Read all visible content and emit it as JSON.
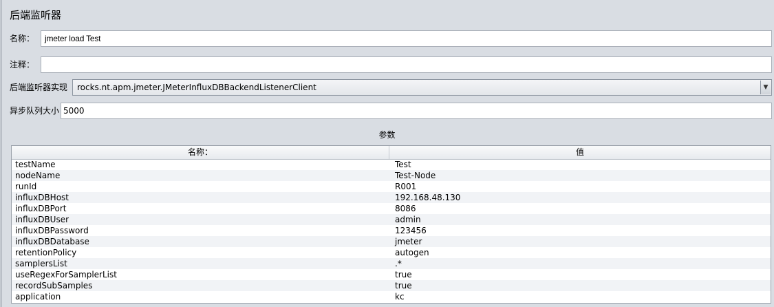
{
  "panel": {
    "title": "后端监听器"
  },
  "form": {
    "name_label": "名称：",
    "name_value": "jmeter load Test",
    "comment_label": "注释：",
    "comment_value": "",
    "impl_label": "后端监听器实现",
    "impl_value": "rocks.nt.apm.jmeter.JMeterInfluxDBBackendListenerClient",
    "queue_label": "异步队列大小",
    "queue_value": "5000"
  },
  "params": {
    "section_title": "参数",
    "headers": [
      "名称：",
      "值"
    ],
    "rows": [
      [
        "testName",
        "Test"
      ],
      [
        "nodeName",
        "Test-Node"
      ],
      [
        "runId",
        "R001"
      ],
      [
        "influxDBHost",
        "192.168.48.130"
      ],
      [
        "influxDBPort",
        "8086"
      ],
      [
        "influxDBUser",
        "admin"
      ],
      [
        "influxDBPassword",
        "123456"
      ],
      [
        "influxDBDatabase",
        "jmeter"
      ],
      [
        "retentionPolicy",
        "autogen"
      ],
      [
        "samplersList",
        ".*"
      ],
      [
        "useRegexForSamplerList",
        "true"
      ],
      [
        "recordSubSamples",
        "true"
      ],
      [
        "application",
        "kc"
      ]
    ]
  },
  "icons": {
    "dropdown": "chevron-down-icon"
  }
}
